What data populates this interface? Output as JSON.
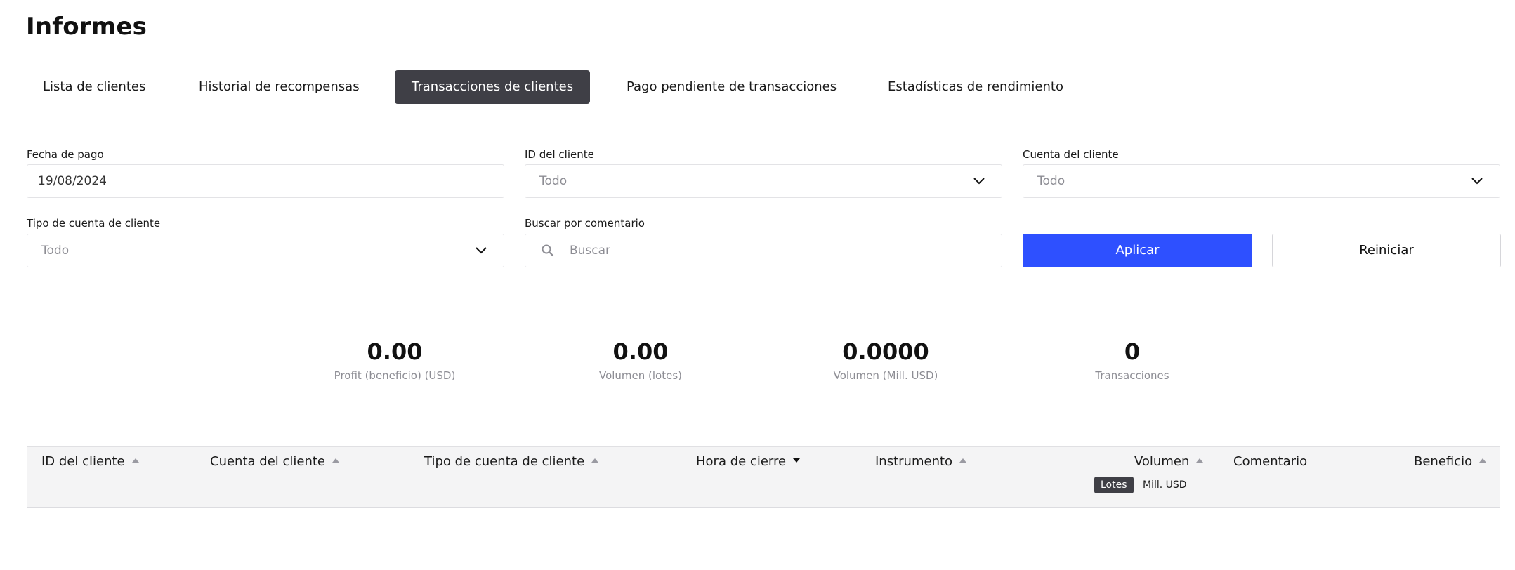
{
  "page": {
    "title": "Informes"
  },
  "tabs": [
    {
      "label": "Lista de clientes",
      "active": false
    },
    {
      "label": "Historial de recompensas",
      "active": false
    },
    {
      "label": "Transacciones de clientes",
      "active": true
    },
    {
      "label": "Pago pendiente de transacciones",
      "active": false
    },
    {
      "label": "Estadísticas de rendimiento",
      "active": false
    }
  ],
  "filters": {
    "payment_date": {
      "label": "Fecha de pago",
      "value": "19/08/2024"
    },
    "client_id": {
      "label": "ID del cliente",
      "value": "Todo",
      "icon": "chevron-down-icon"
    },
    "client_account": {
      "label": "Cuenta del cliente",
      "value": "Todo",
      "icon": "chevron-down-icon"
    },
    "client_account_type": {
      "label": "Tipo de cuenta de cliente",
      "value": "Todo",
      "icon": "chevron-down-icon"
    },
    "comment_search": {
      "label": "Buscar por comentario",
      "placeholder": "Buscar",
      "icon": "search-icon"
    },
    "apply_label": "Aplicar",
    "reset_label": "Reiniciar"
  },
  "stats": [
    {
      "value": "0.00",
      "label": "Profit (beneficio) (USD)"
    },
    {
      "value": "0.00",
      "label": "Volumen (lotes)"
    },
    {
      "value": "0.0000",
      "label": "Volumen (Mill. USD)"
    },
    {
      "value": "0",
      "label": "Transacciones"
    }
  ],
  "table": {
    "columns": [
      {
        "label": "ID del cliente",
        "sort": "asc"
      },
      {
        "label": "Cuenta del cliente",
        "sort": "asc"
      },
      {
        "label": "Tipo de cuenta de cliente",
        "sort": "asc"
      },
      {
        "label": "Hora de cierre",
        "sort": "desc"
      },
      {
        "label": "Instrumento",
        "sort": "asc"
      },
      {
        "label": "Volumen",
        "sort": "asc"
      },
      {
        "label": "Comentario",
        "sort": ""
      },
      {
        "label": "Beneficio",
        "sort": "asc"
      }
    ],
    "volume_units": [
      {
        "label": "Lotes",
        "active": true
      },
      {
        "label": "Mill. USD",
        "active": false
      }
    ],
    "rows": []
  },
  "colors": {
    "primary": "#2e50ff",
    "active_tab": "#3f3f46"
  }
}
